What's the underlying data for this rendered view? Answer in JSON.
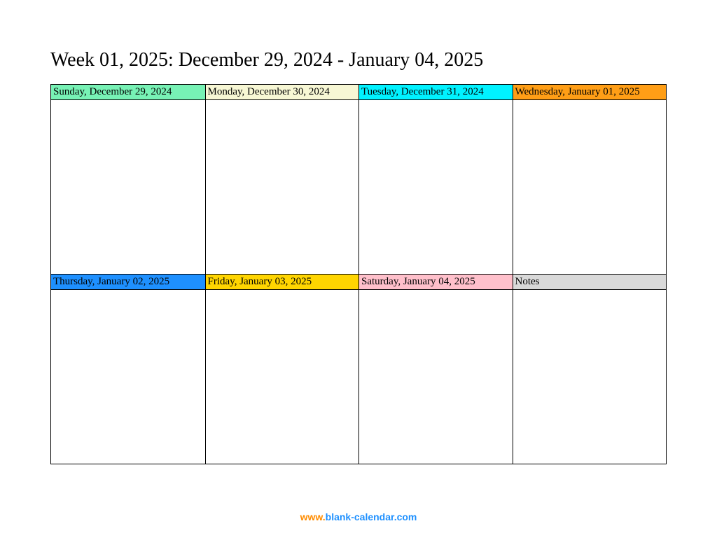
{
  "title": "Week 01, 2025: December 29, 2024 - January 04, 2025",
  "cells": {
    "row1": [
      {
        "label": "Sunday, December 29, 2024",
        "bg": "#77f2b5"
      },
      {
        "label": "Monday, December 30, 2024",
        "bg": "#f7f7d4"
      },
      {
        "label": "Tuesday, December 31, 2024",
        "bg": "#00f2ff"
      },
      {
        "label": "Wednesday, January 01, 2025",
        "bg": "#ff9e16"
      }
    ],
    "row2": [
      {
        "label": "Thursday, January 02, 2025",
        "bg": "#1e90ff"
      },
      {
        "label": "Friday, January 03, 2025",
        "bg": "#ffd500"
      },
      {
        "label": "Saturday, January 04, 2025",
        "bg": "#ffc0cb"
      },
      {
        "label": "Notes",
        "bg": "#d9d9d9"
      }
    ]
  },
  "footer": {
    "prefix": "www.",
    "suffix": "blank-calendar.com"
  }
}
